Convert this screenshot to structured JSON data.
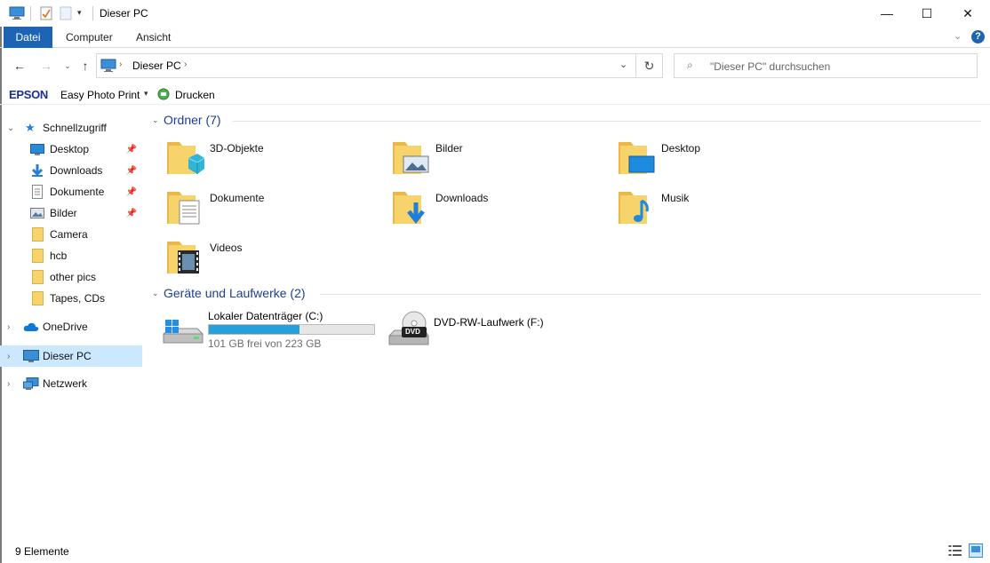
{
  "window": {
    "title": "Dieser PC",
    "minimize": "—",
    "maximize": "☐",
    "close": "✕"
  },
  "ribbon": {
    "tabs": [
      {
        "label": "Datei",
        "active": true
      },
      {
        "label": "Computer",
        "active": false
      },
      {
        "label": "Ansicht",
        "active": false
      }
    ]
  },
  "address": {
    "crumb": "Dieser PC",
    "search_placeholder": "\"Dieser PC\" durchsuchen"
  },
  "epson": {
    "brand": "EPSON",
    "app": "Easy Photo Print",
    "print": "Drucken"
  },
  "nav": {
    "quick_access": "Schnellzugriff",
    "quick_items": [
      {
        "label": "Desktop",
        "icon": "desktop-icon",
        "pinned": true
      },
      {
        "label": "Downloads",
        "icon": "downloads-icon",
        "pinned": true
      },
      {
        "label": "Dokumente",
        "icon": "documents-icon",
        "pinned": true
      },
      {
        "label": "Bilder",
        "icon": "pictures-icon",
        "pinned": true
      },
      {
        "label": "Camera",
        "icon": "folder-icon",
        "pinned": false
      },
      {
        "label": "hcb",
        "icon": "folder-icon",
        "pinned": false
      },
      {
        "label": "other pics",
        "icon": "folder-icon",
        "pinned": false
      },
      {
        "label": "Tapes, CDs",
        "icon": "folder-icon",
        "pinned": false
      }
    ],
    "onedrive": "OneDrive",
    "this_pc": "Dieser PC",
    "network": "Netzwerk"
  },
  "content": {
    "folders_header": "Ordner (7)",
    "folders": [
      {
        "label": "3D-Objekte",
        "icon": "3d-objects-icon"
      },
      {
        "label": "Bilder",
        "icon": "pictures-folder-icon"
      },
      {
        "label": "Desktop",
        "icon": "desktop-folder-icon"
      },
      {
        "label": "Dokumente",
        "icon": "documents-folder-icon"
      },
      {
        "label": "Downloads",
        "icon": "downloads-folder-icon"
      },
      {
        "label": "Musik",
        "icon": "music-folder-icon"
      },
      {
        "label": "Videos",
        "icon": "videos-folder-icon"
      }
    ],
    "drives_header": "Geräte und Laufwerke (2)",
    "drives": [
      {
        "label": "Lokaler Datenträger (C:)",
        "free_text": "101 GB frei von 223 GB",
        "used_fraction": 0.547,
        "icon": "hard-drive-icon"
      },
      {
        "label": "DVD-RW-Laufwerk (F:)",
        "icon": "dvd-drive-icon",
        "badge": "DVD"
      }
    ]
  },
  "status": {
    "count": "9 Elemente"
  },
  "colors": {
    "accent": "#1e64b4",
    "selected_bg": "#cce8ff",
    "header_text": "#1e3f8f",
    "drive_bar": "#26a0da",
    "folder_yellow": "#f6d36b"
  }
}
